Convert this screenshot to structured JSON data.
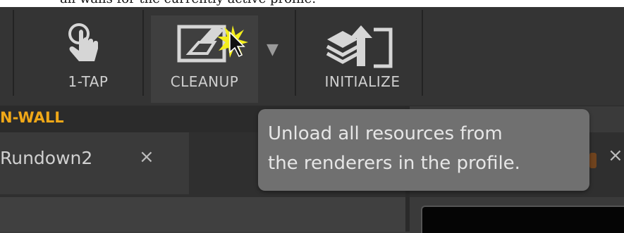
{
  "doc_text": "all walls for the currently active profile.",
  "toolbar": {
    "buttons": [
      {
        "label": "1-TAP",
        "icon": "touch-hand-icon"
      },
      {
        "label": "CLEANUP",
        "icon": "eraser-icon"
      },
      {
        "label": "INITIALIZE",
        "icon": "initialize-stack-icon"
      }
    ]
  },
  "section_label": "N-WALL",
  "tabs": [
    {
      "label": "Rundown2",
      "close": "×"
    },
    {
      "label": "",
      "close": "×"
    }
  ],
  "tooltip": {
    "line1": "Unload all resources from",
    "line2": "the renderers in the profile."
  },
  "colors": {
    "accent": "#f0a818",
    "toolbar_bg": "#343434",
    "tooltip_bg": "#707070"
  }
}
